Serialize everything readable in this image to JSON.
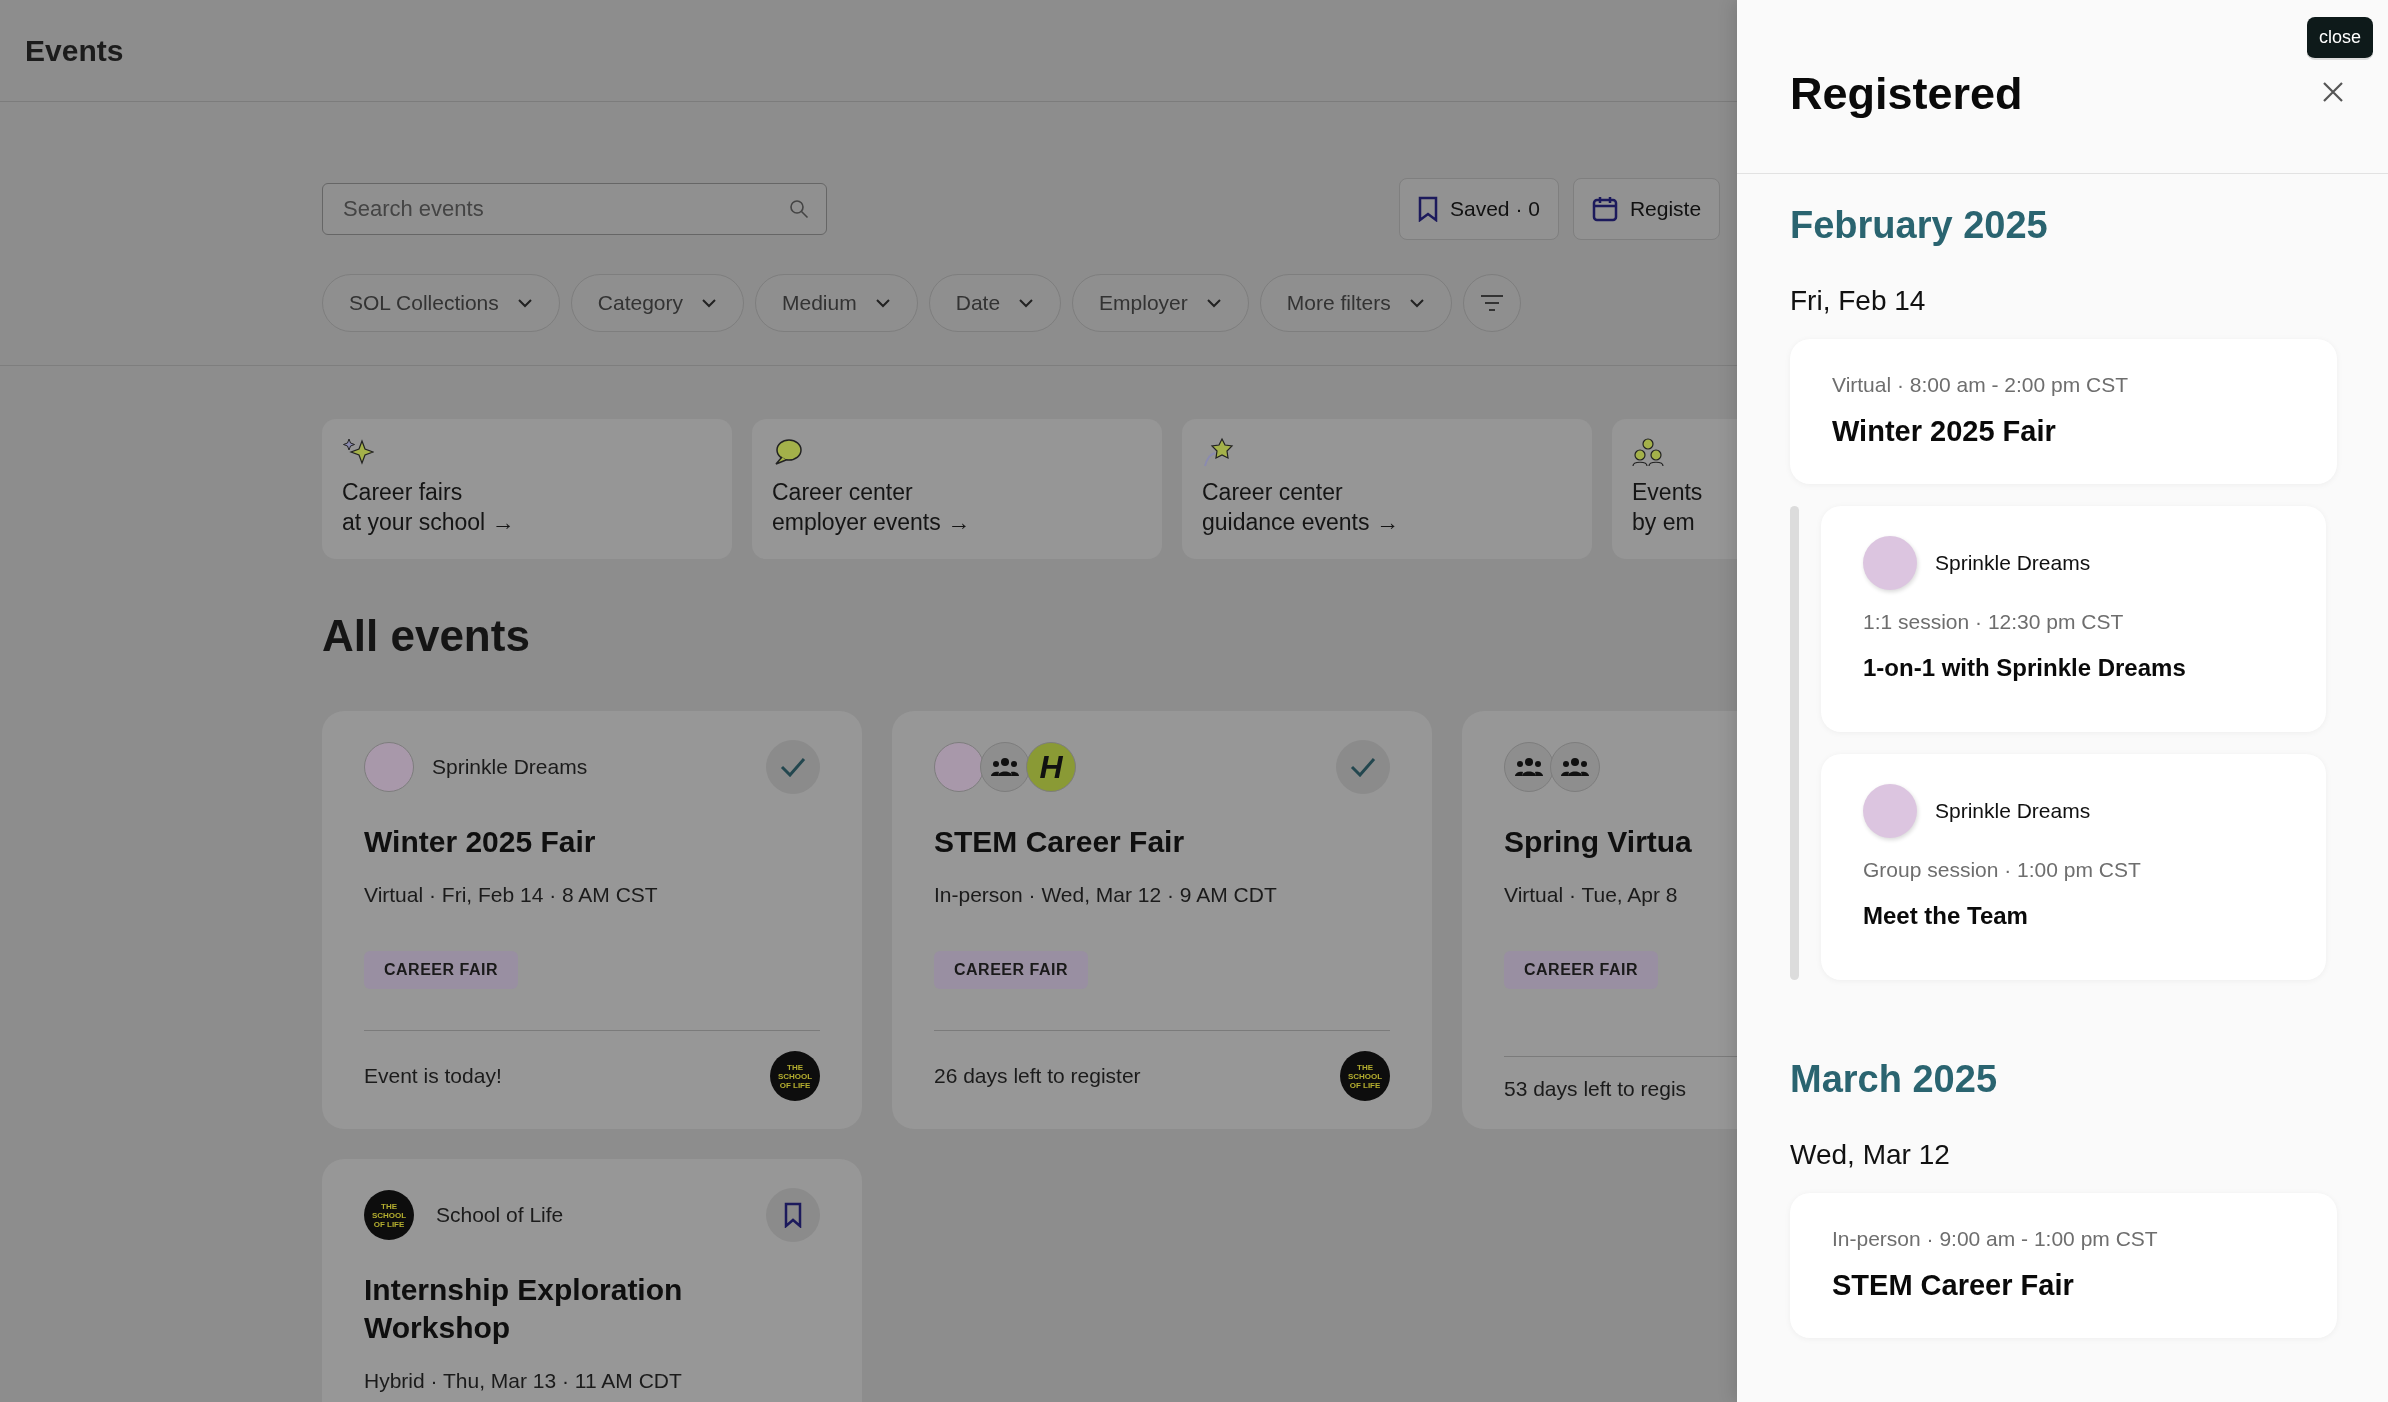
{
  "header": {
    "title": "Events"
  },
  "search": {
    "placeholder": "Search events"
  },
  "actions": [
    {
      "kind": "bookmark",
      "label": "Saved · 0"
    },
    {
      "kind": "calendar",
      "label": "Registe"
    }
  ],
  "filters": [
    {
      "label": "SOL Collections"
    },
    {
      "label": "Category"
    },
    {
      "label": "Medium"
    },
    {
      "label": "Date"
    },
    {
      "label": "Employer"
    },
    {
      "label": "More filters"
    }
  ],
  "collections": [
    {
      "kind": "sparkle",
      "lines": [
        "Career fairs",
        "at your school →"
      ]
    },
    {
      "kind": "bubble",
      "lines": [
        "Career center",
        "employer events →"
      ]
    },
    {
      "kind": "star",
      "lines": [
        "Career center",
        "guidance events →"
      ]
    },
    {
      "kind": "people",
      "lines": [
        "Events",
        "by em"
      ]
    }
  ],
  "section_title": "All events",
  "events": [
    {
      "hosts": [
        {
          "kind": "photo"
        }
      ],
      "host_name": "Sprinkle Dreams",
      "registered": true,
      "title": "Winter 2025 Fair",
      "meta": "Virtual · Fri, Feb 14 · 8 AM CST",
      "tag": "CAREER FAIR",
      "footer": "Event is today!",
      "sponsor": "THE SCHOOL OF LIFE"
    },
    {
      "hosts": [
        {
          "kind": "photo"
        },
        {
          "kind": "group"
        },
        {
          "kind": "letter",
          "text": "H"
        }
      ],
      "registered": true,
      "title": "STEM Career Fair",
      "meta": "In-person · Wed, Mar 12 · 9 AM CDT",
      "tag": "CAREER FAIR",
      "footer": "26 days left to register",
      "sponsor": "THE SCHOOL OF LIFE"
    },
    {
      "hosts": [
        {
          "kind": "group"
        },
        {
          "kind": "group"
        }
      ],
      "title": "Spring Virtua",
      "meta": "Virtual · Tue, Apr 8",
      "tag": "CAREER FAIR",
      "footer": "53 days left to regis"
    },
    {
      "hosts": [
        {
          "kind": "logo",
          "text": "THE SCHOOL OF LIFE"
        }
      ],
      "host_name": "School of Life",
      "registered": false,
      "title": "Internship Exploration Workshop",
      "meta": "Hybrid · Thu, Mar 13 · 11 AM CDT"
    }
  ],
  "drawer": {
    "tooltip": "close",
    "title": "Registered",
    "months": [
      {
        "label": "February 2025",
        "days": [
          {
            "label": "Fri, Feb 14",
            "event": {
              "meta": "Virtual · 8:00 am - 2:00 pm CST",
              "title": "Winter 2025 Fair"
            },
            "sessions": [
              {
                "host": "Sprinkle Dreams",
                "meta": "1:1 session · 12:30 pm CST",
                "title": "1-on-1 with Sprinkle Dreams"
              },
              {
                "host": "Sprinkle Dreams",
                "meta": "Group session · 1:00 pm CST",
                "title": "Meet the Team"
              }
            ]
          }
        ]
      },
      {
        "label": "March 2025",
        "days": [
          {
            "label": "Wed, Mar 12",
            "event": {
              "meta": "In-person · 9:00 am - 1:00 pm CST",
              "title": "STEM Career Fair"
            }
          }
        ]
      }
    ]
  }
}
